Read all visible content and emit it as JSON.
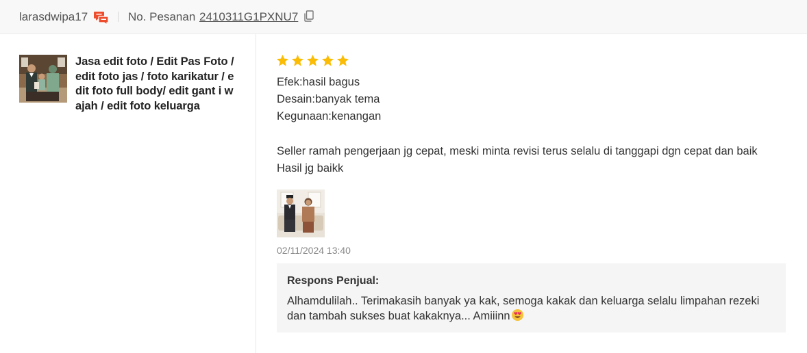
{
  "header": {
    "username": "larasdwipa17",
    "chat_icon": "chat-bubbles-icon",
    "order_label": "No. Pesanan",
    "order_number": "2410311G1PXNU7",
    "copy_icon": "copy-icon"
  },
  "product": {
    "thumbnail": "family-portrait-thumbnail",
    "name": "Jasa edit foto / Edit Pas Foto / edit foto jas / foto karikatur / edit foto full body/ edit gant i wajah / edit foto keluarga"
  },
  "review": {
    "rating": 5,
    "rating_max": 5,
    "star_color": "#fbbc05",
    "attributes": [
      "Efek:hasil bagus",
      "Desain:banyak tema",
      "Kegunaan:kenangan"
    ],
    "comment_line1": "Seller ramah pengerjaan jg cepat, meski minta revisi terus selalu di tanggapi dgn cepat dan baik",
    "comment_line2": "Hasil jg baikk",
    "photo": "couple-photo-thumbnail",
    "timestamp": "02/11/2024 13:40"
  },
  "seller_response": {
    "title": "Respons Penjual:",
    "text": "Alhamdulilah.. Terimakasih banyak ya kak, semoga kakak dan keluarga selalu limpahan rezeki dan tambah sukses buat kakaknya... Amiiinn",
    "emoji": "heart-eyes-emoji"
  },
  "colors": {
    "accent_icon": "#ee4d2d",
    "header_bg": "#f8f8f8",
    "response_bg": "#f5f5f5"
  }
}
